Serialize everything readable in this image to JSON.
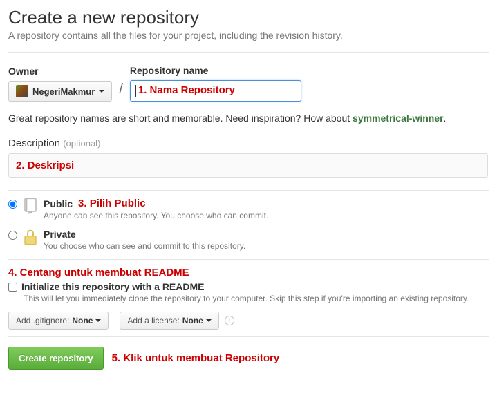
{
  "header": {
    "title": "Create a new repository",
    "subtitle": "A repository contains all the files for your project, including the revision history."
  },
  "owner": {
    "label": "Owner",
    "name": "NegeriMakmur"
  },
  "repo": {
    "label": "Repository name",
    "value": ""
  },
  "hint": {
    "prefix": "Great repository names are short and memorable. Need inspiration? How about ",
    "suggestion": "symmetrical-winner",
    "suffix": "."
  },
  "description": {
    "label": "Description",
    "optional": "(optional)",
    "value": ""
  },
  "visibility": {
    "public": {
      "title": "Public",
      "desc": "Anyone can see this repository. You choose who can commit."
    },
    "private": {
      "title": "Private",
      "desc": "You choose who can see and commit to this repository."
    }
  },
  "readme": {
    "label": "Initialize this repository with a README",
    "desc": "This will let you immediately clone the repository to your computer. Skip this step if you're importing an existing repository."
  },
  "gitignore": {
    "prefix": "Add .gitignore: ",
    "value": "None"
  },
  "license": {
    "prefix": "Add a license: ",
    "value": "None"
  },
  "submit": {
    "label": "Create repository"
  },
  "annotations": {
    "a1": "1. Nama Repository",
    "a2": "2. Deskripsi",
    "a3": "3. Pilih Public",
    "a4": "4. Centang untuk membuat README",
    "a5": "5. Klik untuk membuat Repository"
  }
}
